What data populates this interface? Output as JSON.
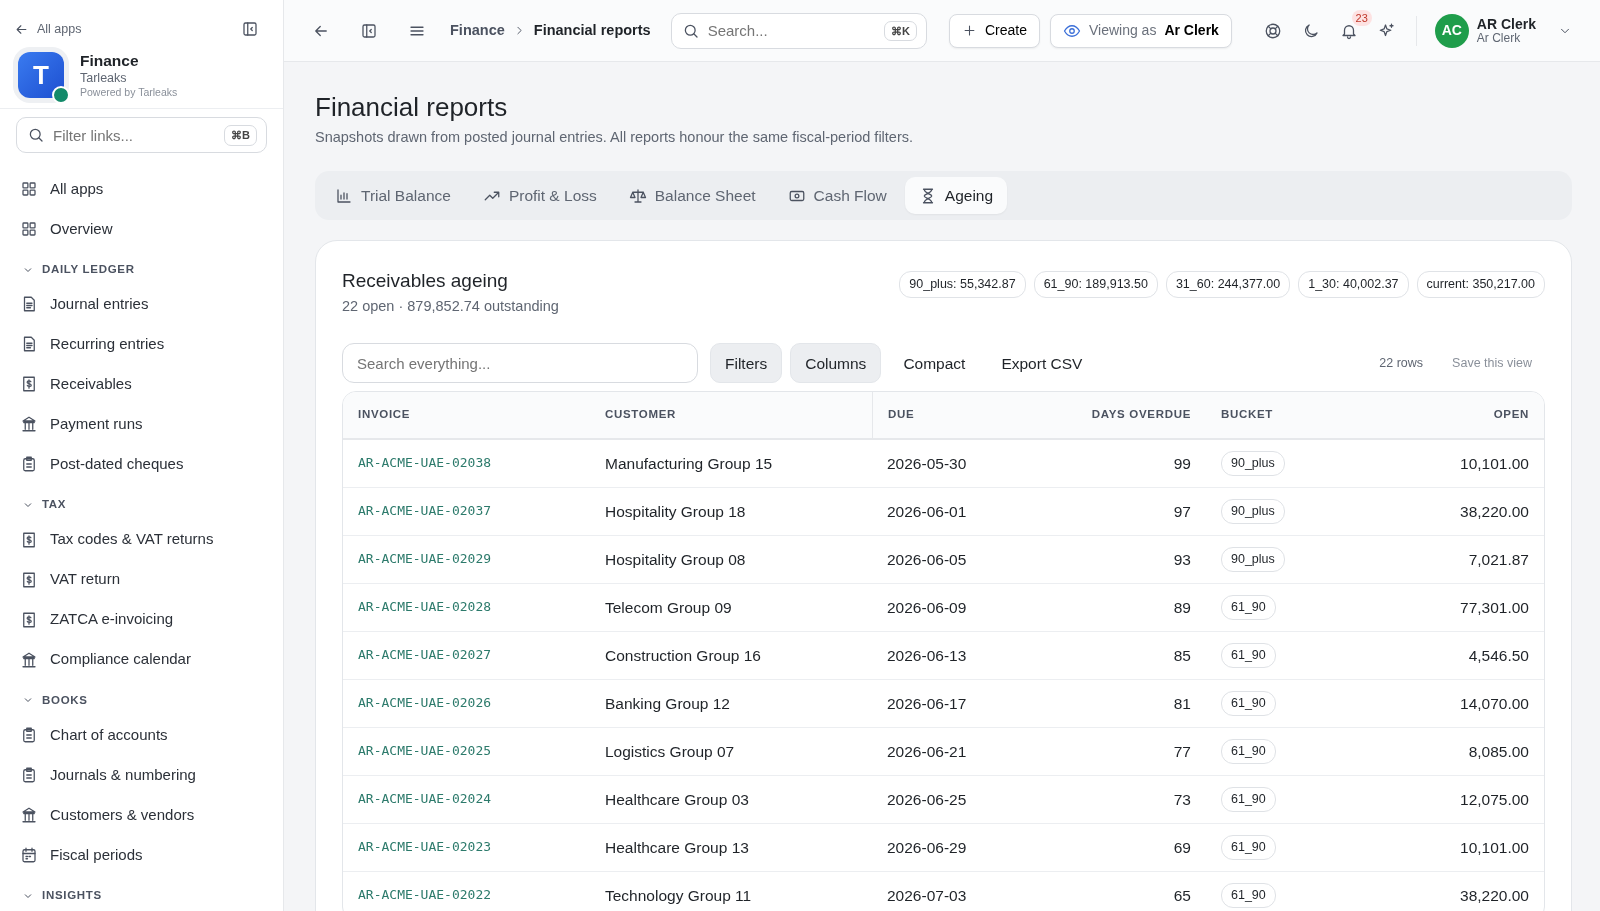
{
  "sidebar": {
    "back_link": "All apps",
    "app": {
      "name": "Finance",
      "org": "Tarleaks",
      "powered_by": "Powered by Tarleaks",
      "logo_letter": "T"
    },
    "filter": {
      "placeholder": "Filter links...",
      "shortcut": "⌘B"
    },
    "top_items": [
      {
        "label": "All apps",
        "selected": false
      },
      {
        "label": "Overview",
        "selected": false
      }
    ],
    "sections": [
      {
        "title": "DAILY LEDGER",
        "expanded": true,
        "items": [
          {
            "label": "Journal entries",
            "selected": false
          },
          {
            "label": "Recurring entries",
            "selected": false
          },
          {
            "label": "Receivables",
            "selected": false
          },
          {
            "label": "Payment runs",
            "selected": false
          },
          {
            "label": "Post-dated cheques",
            "selected": false
          }
        ]
      },
      {
        "title": "TAX",
        "expanded": true,
        "items": [
          {
            "label": "Tax codes & VAT returns",
            "selected": false
          },
          {
            "label": "VAT return",
            "selected": false
          },
          {
            "label": "ZATCA e-invoicing",
            "selected": false
          },
          {
            "label": "Compliance calendar",
            "selected": false
          }
        ]
      },
      {
        "title": "BOOKS",
        "expanded": true,
        "items": [
          {
            "label": "Chart of accounts",
            "selected": false
          },
          {
            "label": "Journals & numbering",
            "selected": false
          },
          {
            "label": "Customers & vendors",
            "selected": false
          },
          {
            "label": "Fiscal periods",
            "selected": false
          }
        ]
      },
      {
        "title": "INSIGHTS",
        "expanded": true
      }
    ]
  },
  "topbar": {
    "breadcrumb": [
      "Finance",
      "Financial reports"
    ],
    "search": {
      "placeholder": "Search...",
      "shortcut": "⌘K"
    },
    "create": "Create",
    "viewing_label": "Viewing as",
    "viewing_name": "Ar Clerk",
    "notifications": "23",
    "user": {
      "initials": "AC",
      "name": "AR Clerk",
      "role": "Ar Clerk"
    }
  },
  "page": {
    "title": "Financial reports",
    "subtitle": "Snapshots drawn from posted journal entries. All reports honour the same fiscal-period filters.",
    "tabs": [
      {
        "label": "Trial Balance",
        "selected": false
      },
      {
        "label": "Profit & Loss",
        "selected": false
      },
      {
        "label": "Balance Sheet",
        "selected": false
      },
      {
        "label": "Cash Flow",
        "selected": false
      },
      {
        "label": "Ageing",
        "selected": true
      }
    ]
  },
  "report": {
    "title": "Receivables ageing",
    "summary": "22 open · 879,852.74 outstanding",
    "totals": [
      "90_plus: 55,342.87",
      "61_90: 189,913.50",
      "31_60: 244,377.00",
      "1_30: 40,002.37",
      "current: 350,217.00"
    ],
    "search": {
      "placeholder": "Search everything..."
    },
    "actions": [
      {
        "label": "Filters",
        "active": true
      },
      {
        "label": "Columns",
        "active": true
      },
      {
        "label": "Compact",
        "active": false
      },
      {
        "label": "Export CSV",
        "active": false
      }
    ],
    "row_count": "22 rows",
    "save_view": "Save this view",
    "table": {
      "columns": [
        "INVOICE",
        "CUSTOMER",
        "DUE",
        "DAYS OVERDUE",
        "BUCKET",
        "OPEN"
      ],
      "rows": [
        [
          "AR-ACME-UAE-02038",
          "Manufacturing Group 15",
          "2026-05-30",
          "99",
          "90_plus",
          "10,101.00"
        ],
        [
          "AR-ACME-UAE-02037",
          "Hospitality Group 18",
          "2026-06-01",
          "97",
          "90_plus",
          "38,220.00"
        ],
        [
          "AR-ACME-UAE-02029",
          "Hospitality Group 08",
          "2026-06-05",
          "93",
          "90_plus",
          "7,021.87"
        ],
        [
          "AR-ACME-UAE-02028",
          "Telecom Group 09",
          "2026-06-09",
          "89",
          "61_90",
          "77,301.00"
        ],
        [
          "AR-ACME-UAE-02027",
          "Construction Group 16",
          "2026-06-13",
          "85",
          "61_90",
          "4,546.50"
        ],
        [
          "AR-ACME-UAE-02026",
          "Banking Group 12",
          "2026-06-17",
          "81",
          "61_90",
          "14,070.00"
        ],
        [
          "AR-ACME-UAE-02025",
          "Logistics Group 07",
          "2026-06-21",
          "77",
          "61_90",
          "8,085.00"
        ],
        [
          "AR-ACME-UAE-02024",
          "Healthcare Group 03",
          "2026-06-25",
          "73",
          "61_90",
          "12,075.00"
        ],
        [
          "AR-ACME-UAE-02023",
          "Healthcare Group 13",
          "2026-06-29",
          "69",
          "61_90",
          "10,101.00"
        ],
        [
          "AR-ACME-UAE-02022",
          "Technology Group 11",
          "2026-07-03",
          "65",
          "61_90",
          "38,220.00"
        ]
      ]
    }
  }
}
